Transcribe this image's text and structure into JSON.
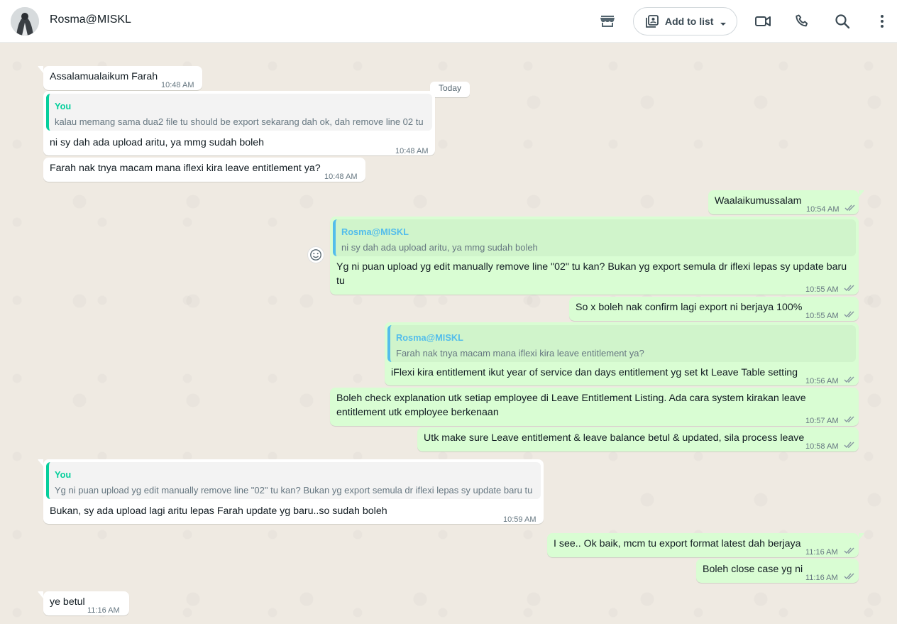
{
  "header": {
    "contact_name": "Rosma@MISKL",
    "add_to_list_label": "Add to list",
    "icons": [
      "store-icon",
      "add-to-list-icon",
      "chevron-down-icon",
      "video-call-icon",
      "phone-icon",
      "search-icon",
      "more-options-icon"
    ]
  },
  "chat": {
    "date_label": "Today",
    "messages": [
      {
        "dir": "in",
        "text": "Assalamualaikum Farah",
        "time": "10:48 AM"
      },
      {
        "dir": "in",
        "quote_author": "You",
        "quote_text": "kalau memang sama dua2 file tu should be export sekarang dah ok, dah remove line 02 tu",
        "text": "ni sy dah ada upload aritu, ya mmg sudah boleh",
        "time": "10:48 AM"
      },
      {
        "dir": "in",
        "text": "Farah nak tnya macam mana iflexi kira leave entitlement ya?",
        "time": "10:48 AM"
      },
      {
        "dir": "out",
        "text": "Waalaikumussalam",
        "time": "10:54 AM"
      },
      {
        "dir": "out",
        "quote_author": "Rosma@MISKL",
        "quote_text": "ni sy dah ada upload aritu, ya mmg sudah boleh",
        "text": "Yg ni puan upload yg edit manually remove line \"02\" tu kan? Bukan yg export semula dr iflexi lepas sy update baru tu",
        "time": "10:55 AM"
      },
      {
        "dir": "out",
        "text": "So x boleh nak confirm lagi export ni berjaya 100%",
        "time": "10:55 AM"
      },
      {
        "dir": "out",
        "quote_author": "Rosma@MISKL",
        "quote_text": "Farah nak tnya macam mana iflexi kira leave entitlement ya?",
        "text": "iFlexi kira entitlement ikut year of service dan days entitlement yg set kt Leave Table setting",
        "time": "10:56 AM"
      },
      {
        "dir": "out",
        "text": "Boleh check explanation utk setiap employee di Leave Entitlement Listing. Ada cara system kirakan leave entitlement utk employee berkenaan",
        "time": "10:57 AM"
      },
      {
        "dir": "out",
        "text": "Utk make sure Leave entitlement & leave balance betul & updated, sila process leave",
        "time": "10:58 AM"
      },
      {
        "dir": "in",
        "quote_author": "You",
        "quote_text": "Yg ni puan upload yg edit manually remove line \"02\" tu kan? Bukan yg export semula dr iflexi lepas sy update baru tu",
        "text": "Bukan, sy ada upload lagi aritu lepas Farah update yg baru..so sudah boleh",
        "time": "10:59 AM"
      },
      {
        "dir": "out",
        "text": "I see.. Ok baik, mcm tu export format latest dah berjaya",
        "time": "11:16 AM"
      },
      {
        "dir": "out",
        "text": "Boleh close case yg ni",
        "time": "11:16 AM"
      },
      {
        "dir": "in",
        "text": "ye betul",
        "time": "11:16 AM"
      }
    ]
  },
  "colors": {
    "incoming_bubble": "#ffffff",
    "outgoing_bubble": "#d9fdd3",
    "chat_background": "#efeae2",
    "quote_accent_in": "#06cf9c",
    "quote_accent_out": "#53bdeb",
    "read_ticks": "#8696a0"
  }
}
